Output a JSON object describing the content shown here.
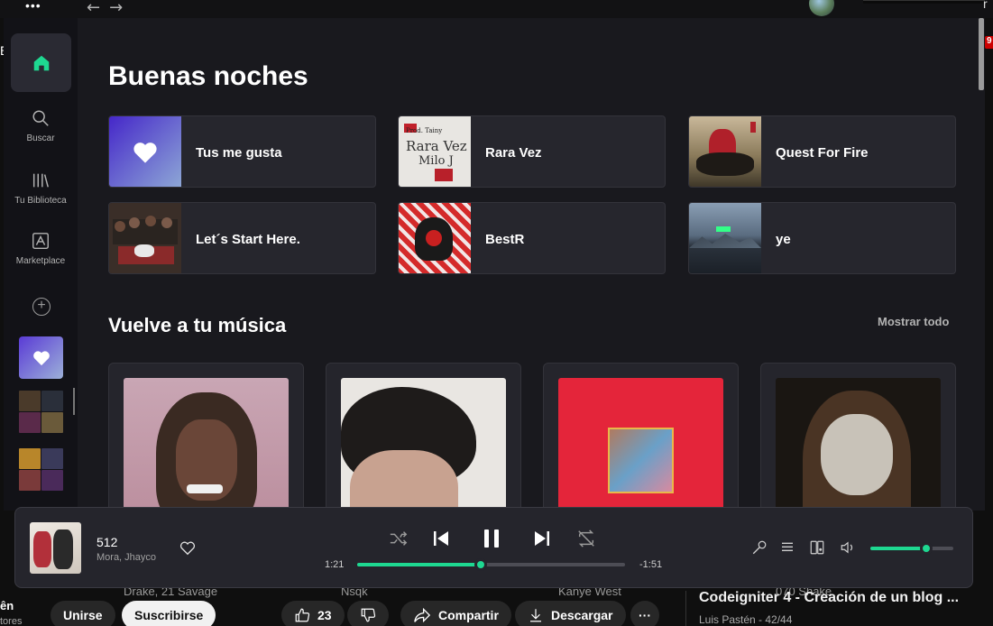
{
  "browser": {
    "edge_char": "r",
    "left_edge_char": "E",
    "notification_count": "9"
  },
  "sidebar": {
    "items": [
      {
        "label": "Buscar"
      },
      {
        "label": "Tu Biblioteca"
      },
      {
        "label": "Marketplace"
      }
    ]
  },
  "home": {
    "greeting": "Buenas noches",
    "quick_tiles": [
      {
        "label": "Tus me gusta"
      },
      {
        "label": "Rara Vez"
      },
      {
        "label": "Quest For Fire"
      },
      {
        "label": "Let´s Start Here."
      },
      {
        "label": "BestR"
      },
      {
        "label": "ye"
      }
    ],
    "section_title": "Vuelve a tu música",
    "show_all": "Mostrar todo",
    "cards": [
      {
        "subtitle": "Drake, 21 Savage"
      },
      {
        "subtitle": "Nsqk"
      },
      {
        "subtitle": "Kanye West"
      },
      {
        "subtitle": "070 Shake"
      }
    ],
    "tile_art_text": {
      "rara_vez_1": "Prod. Tainy",
      "rara_vez_2": "Rara Vez",
      "rara_vez_3": "Milo J"
    }
  },
  "player": {
    "title": "512",
    "artist": "Mora, Jhayco",
    "elapsed": "1:21",
    "remaining": "-1:51",
    "progress": 0.46,
    "volume": 0.67
  },
  "youtube": {
    "left_title": "ên",
    "left_sub": "tores",
    "join": "Unirse",
    "subscribe": "Suscribirse",
    "likes": "23",
    "share": "Compartir",
    "download": "Descargar",
    "more": "···",
    "side_title": "Codeigniter 4 - Creación de un blog ...",
    "side_meta": "Luis Pastén - 42/44"
  },
  "colors": {
    "accent": "#1ed891",
    "bg": "#19191e",
    "tile": "#26262d"
  }
}
